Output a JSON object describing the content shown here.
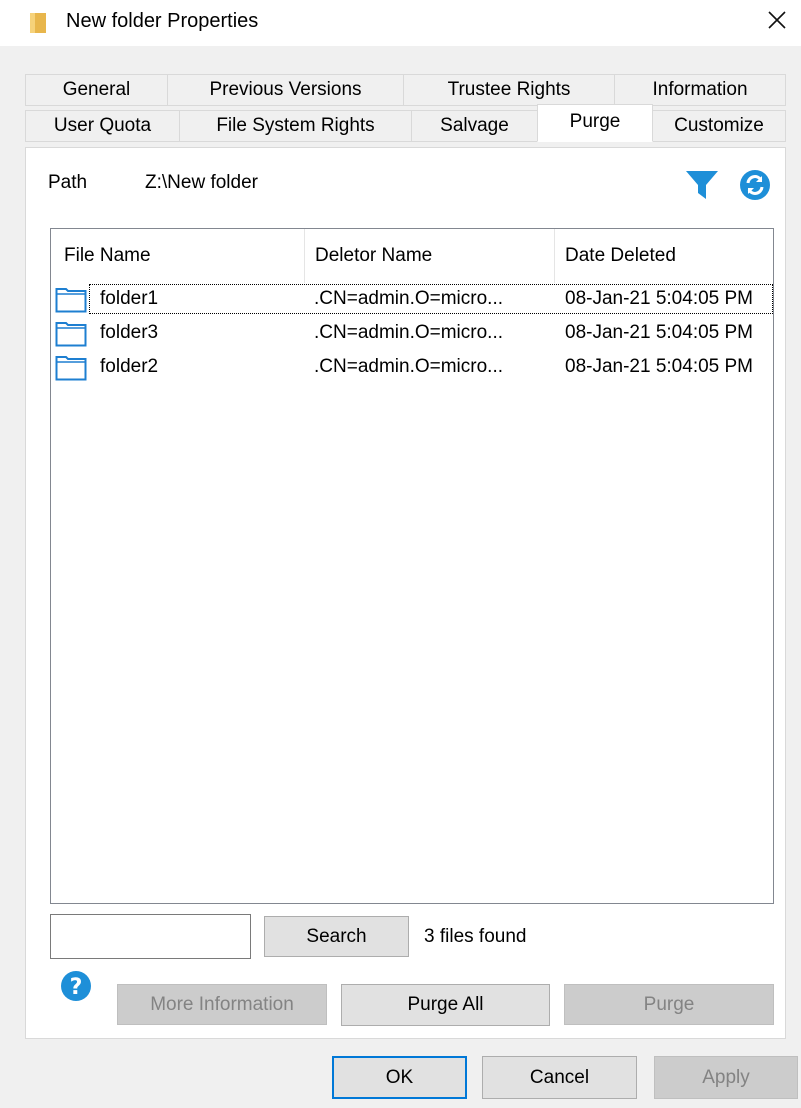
{
  "window": {
    "title": "New folder Properties"
  },
  "tabs": {
    "row1": [
      {
        "label": "General"
      },
      {
        "label": "Previous Versions"
      },
      {
        "label": "Trustee Rights"
      },
      {
        "label": "Information"
      }
    ],
    "row2": [
      {
        "label": "User Quota"
      },
      {
        "label": "File System Rights"
      },
      {
        "label": "Salvage"
      },
      {
        "label": "Purge",
        "active": true
      },
      {
        "label": "Customize"
      }
    ]
  },
  "path": {
    "label": "Path",
    "value": "Z:\\New folder"
  },
  "list": {
    "columns": [
      "File Name",
      "Deletor Name",
      "Date Deleted"
    ],
    "rows": [
      {
        "name": "folder1",
        "deletor": ".CN=admin.O=micro...",
        "date": "08-Jan-21 5:04:05 PM"
      },
      {
        "name": "folder3",
        "deletor": ".CN=admin.O=micro...",
        "date": "08-Jan-21 5:04:05 PM"
      },
      {
        "name": "folder2",
        "deletor": ".CN=admin.O=micro...",
        "date": "08-Jan-21 5:04:05 PM"
      }
    ]
  },
  "search": {
    "input_value": "",
    "button_label": "Search",
    "result_text": "3 files found"
  },
  "actions": {
    "more_info_label": "More Information",
    "purge_all_label": "Purge All",
    "purge_label": "Purge"
  },
  "footer": {
    "ok_label": "OK",
    "cancel_label": "Cancel",
    "apply_label": "Apply"
  },
  "colors": {
    "accent": "#1e8fd8",
    "folder_icon": "#1e7fd1",
    "title_folder": "#e8b64c"
  },
  "icons": {
    "title": "folder-icon",
    "close": "close-icon",
    "filter": "filter-icon",
    "refresh": "refresh-icon",
    "help": "help-icon",
    "row": "folder-outline-icon",
    "scroll_left": "chevron-left-icon",
    "scroll_right": "chevron-right-icon"
  }
}
